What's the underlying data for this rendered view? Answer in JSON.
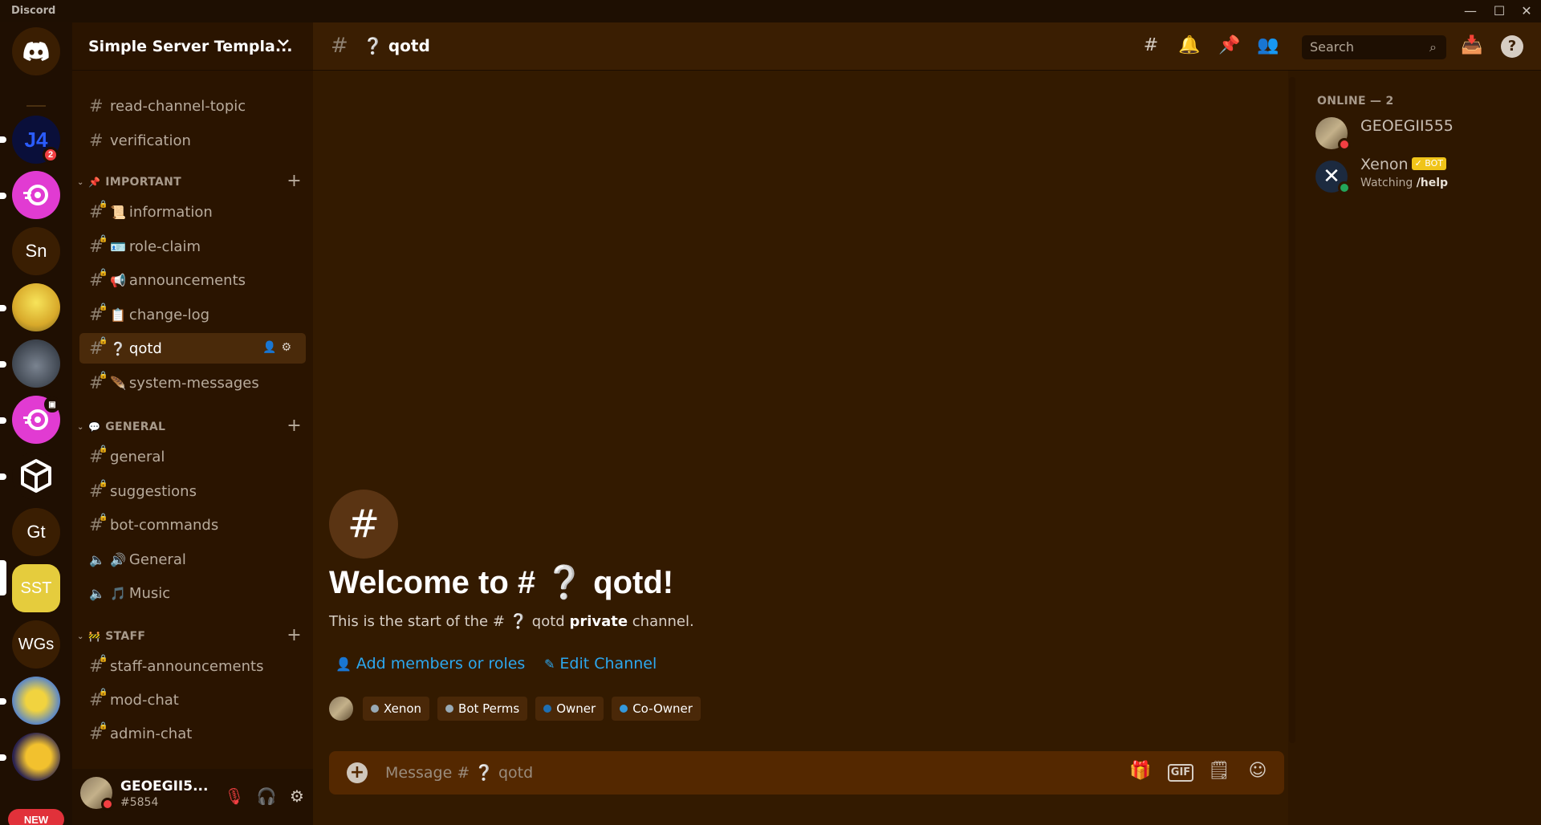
{
  "app": {
    "title": "Discord"
  },
  "window": {
    "minimize": "—",
    "maximize": "☐",
    "close": "✕"
  },
  "rail": {
    "servers": [
      {
        "label": "",
        "unread_count": "2"
      },
      {
        "label": ""
      },
      {
        "label": "Sn"
      },
      {
        "label": ""
      },
      {
        "label": ""
      },
      {
        "label": ""
      },
      {
        "label": ""
      },
      {
        "label": "Gt"
      },
      {
        "label": "SST"
      },
      {
        "label": "WGs"
      },
      {
        "label": ""
      },
      {
        "label": ""
      }
    ],
    "new_badge": "NEW"
  },
  "server": {
    "name": "Simple Server Templa..."
  },
  "channels": {
    "top": [
      "read-channel-topic",
      "verification"
    ],
    "important": {
      "label": "IMPORTANT",
      "items": [
        {
          "emoji": "📜",
          "name": "information"
        },
        {
          "emoji": "🪪",
          "name": "role-claim"
        },
        {
          "emoji": "📢",
          "name": "announcements"
        },
        {
          "emoji": "📋",
          "name": "change-log"
        },
        {
          "emoji": "❔",
          "name": "qotd"
        },
        {
          "emoji": "🪶",
          "name": "system-messages"
        }
      ]
    },
    "general": {
      "label": "GENERAL",
      "text": [
        "general",
        "suggestions",
        "bot-commands"
      ],
      "voice": [
        {
          "emoji": "🔊",
          "name": "General"
        },
        {
          "emoji": "🎵",
          "name": "Music"
        }
      ]
    },
    "staff": {
      "label": "STAFF",
      "items": [
        "staff-announcements",
        "mod-chat",
        "admin-chat"
      ]
    }
  },
  "user": {
    "name": "GEOEGII5...",
    "tag": "#5854"
  },
  "header": {
    "channel_title": "❔ qotd",
    "search_placeholder": "Search"
  },
  "welcome": {
    "title": "Welcome to # ❔ qotd!",
    "sub_prefix": "This is the start of the # ❔ qotd ",
    "sub_bold": "private",
    "sub_suffix": " channel.",
    "add_members": "Add members or roles",
    "edit_channel": "Edit Channel",
    "roles": [
      {
        "name": "Xenon",
        "color": "#99aab5"
      },
      {
        "name": "Bot Perms",
        "color": "#99aab5"
      },
      {
        "name": "Owner",
        "color": "#1f6fb2"
      },
      {
        "name": "Co-Owner",
        "color": "#3498db"
      }
    ]
  },
  "composer": {
    "placeholder": "Message # ❔ qotd",
    "gif": "GIF"
  },
  "members": {
    "header": "ONLINE — 2",
    "list": [
      {
        "name": "GEOEGII555",
        "status": "dnd",
        "activity": ""
      },
      {
        "name": "Xenon",
        "status": "online",
        "bot_tag": "✓ BOT",
        "activity_prefix": "Watching ",
        "activity_bold": "/help"
      }
    ]
  },
  "colors": {
    "accent_link": "#2ca8f0",
    "dnd": "#f23f42",
    "online": "#23a55a",
    "background": "#331a00"
  }
}
